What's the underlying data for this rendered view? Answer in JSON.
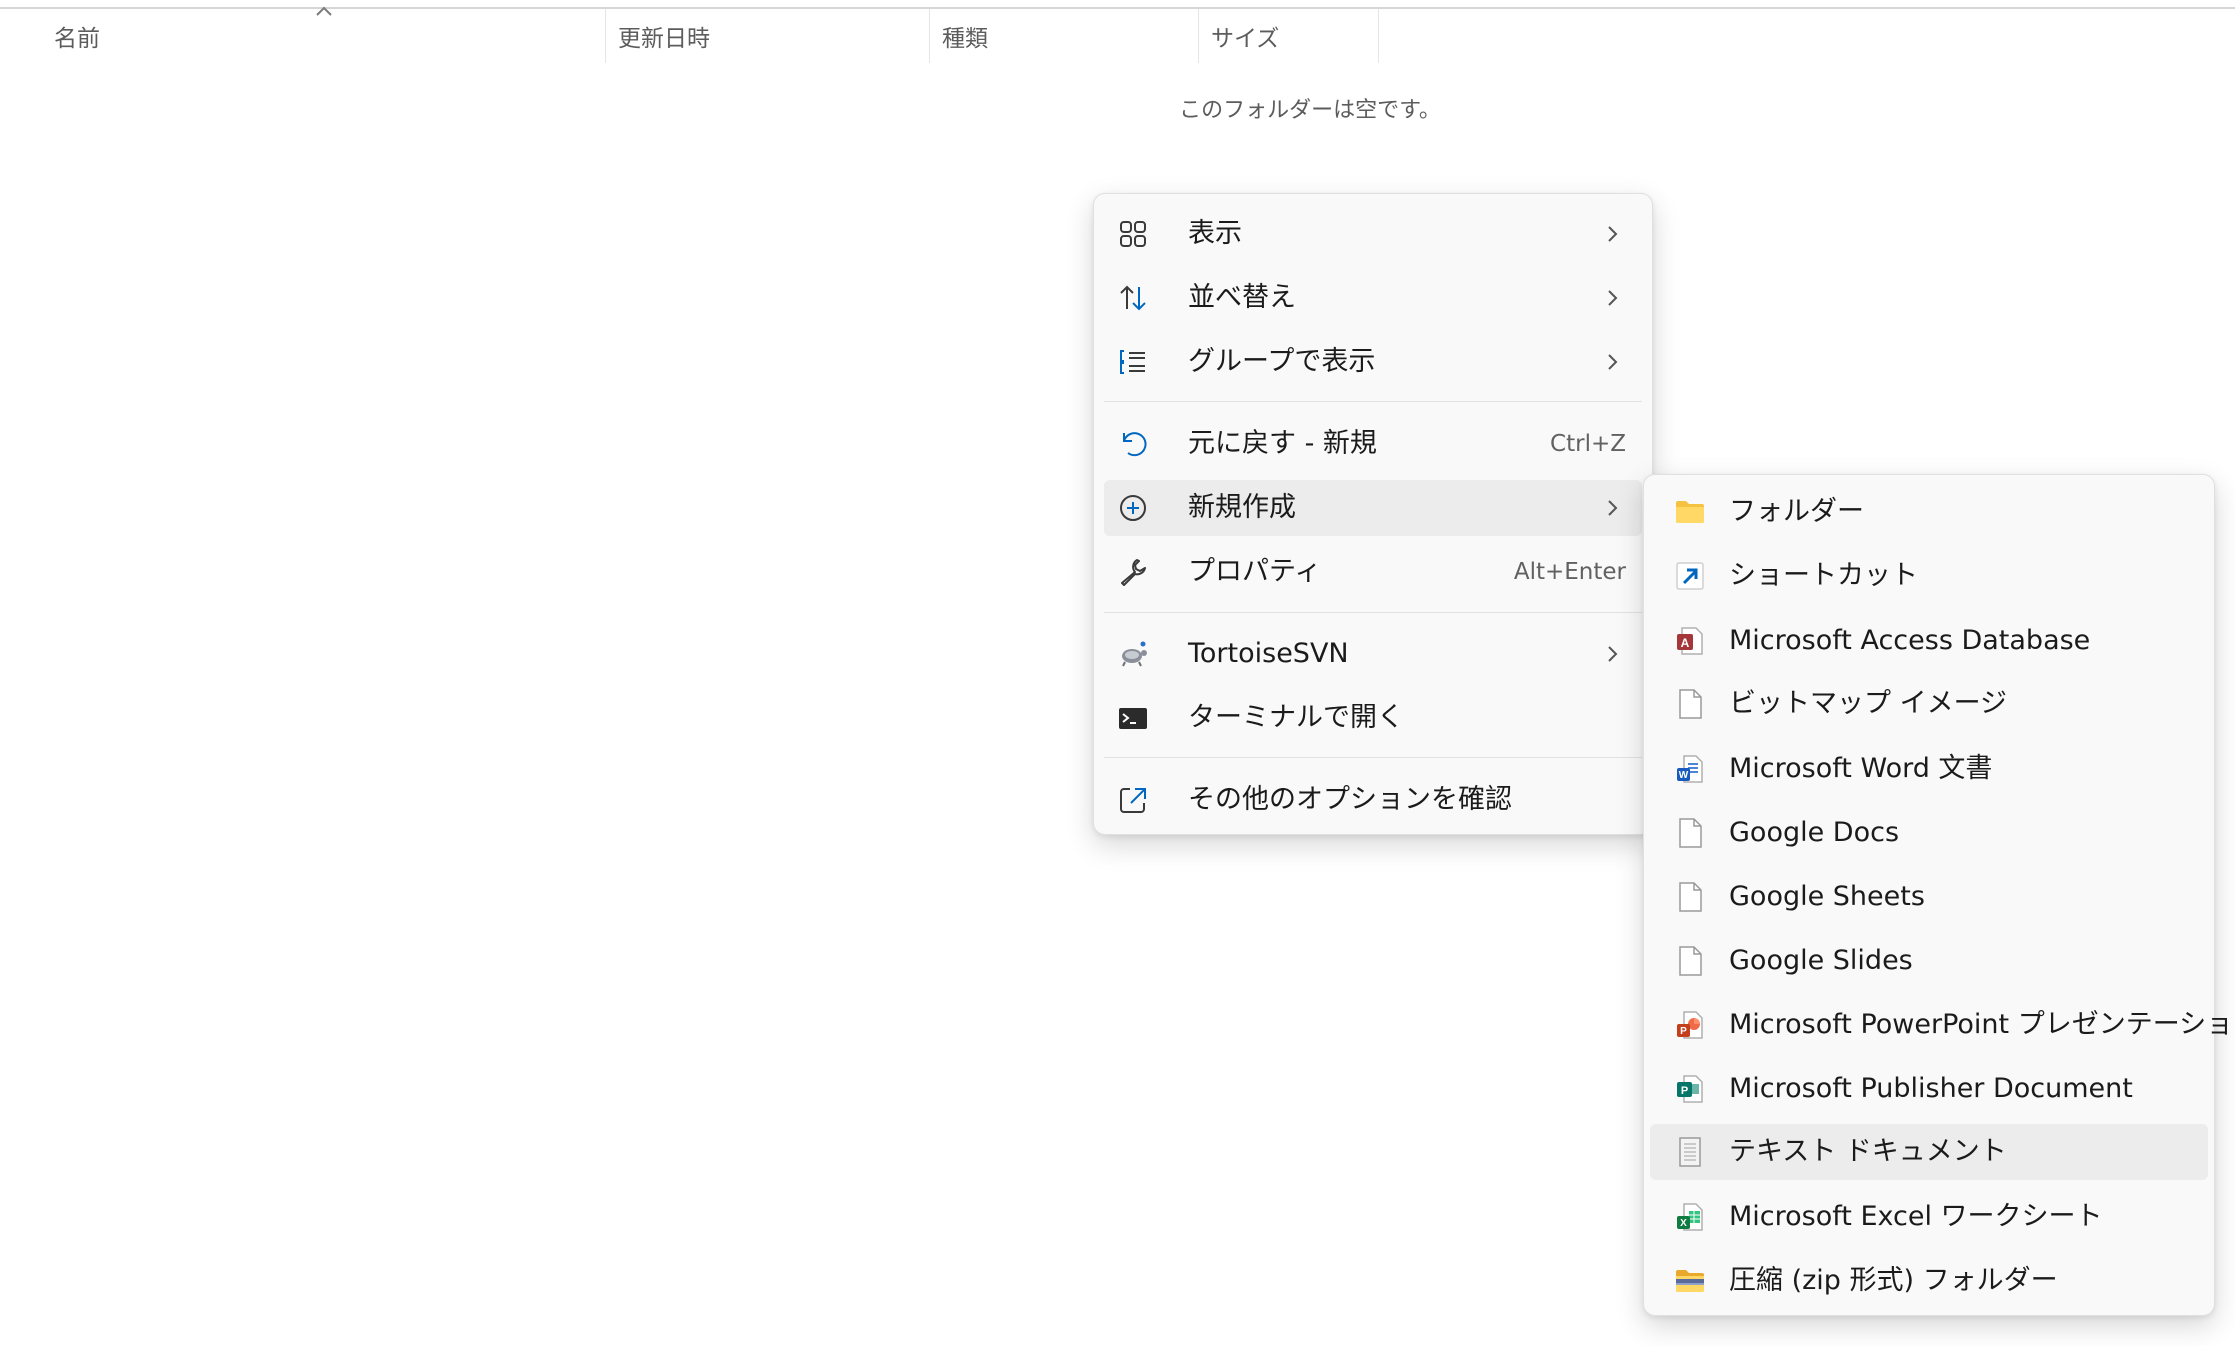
{
  "columns": {
    "name": "名前",
    "modified": "更新日時",
    "type": "種類",
    "size": "サイズ"
  },
  "empty_message": "このフォルダーは空です。",
  "context_menu": {
    "view": "表示",
    "sort": "並べ替え",
    "group": "グループで表示",
    "undo": "元に戻す - 新規",
    "undo_shortcut": "Ctrl+Z",
    "new": "新規作成",
    "properties": "プロパティ",
    "properties_shortcut": "Alt+Enter",
    "tortoisesvn": "TortoiseSVN",
    "terminal": "ターミナルで開く",
    "more_options": "その他のオプションを確認"
  },
  "new_submenu": {
    "items": [
      {
        "label": "フォルダー",
        "icon": "folder-icon"
      },
      {
        "label": "ショートカット",
        "icon": "shortcut-icon"
      },
      {
        "label": "Microsoft Access Database",
        "icon": "access-icon"
      },
      {
        "label": "ビットマップ イメージ",
        "icon": "blank-file-icon"
      },
      {
        "label": "Microsoft Word 文書",
        "icon": "word-icon"
      },
      {
        "label": "Google Docs",
        "icon": "blank-file-icon"
      },
      {
        "label": "Google Sheets",
        "icon": "blank-file-icon"
      },
      {
        "label": "Google Slides",
        "icon": "blank-file-icon"
      },
      {
        "label": "Microsoft PowerPoint プレゼンテーション",
        "icon": "powerpoint-icon"
      },
      {
        "label": "Microsoft Publisher Document",
        "icon": "publisher-icon"
      },
      {
        "label": "テキスト ドキュメント",
        "icon": "text-file-icon"
      },
      {
        "label": "Microsoft Excel ワークシート",
        "icon": "excel-icon"
      },
      {
        "label": "圧縮 (zip 形式) フォルダー",
        "icon": "zip-folder-icon"
      }
    ]
  },
  "colors": {
    "accent": "#0067c0",
    "menu_bg": "#f9f9f9",
    "hover_bg": "#ececec"
  }
}
